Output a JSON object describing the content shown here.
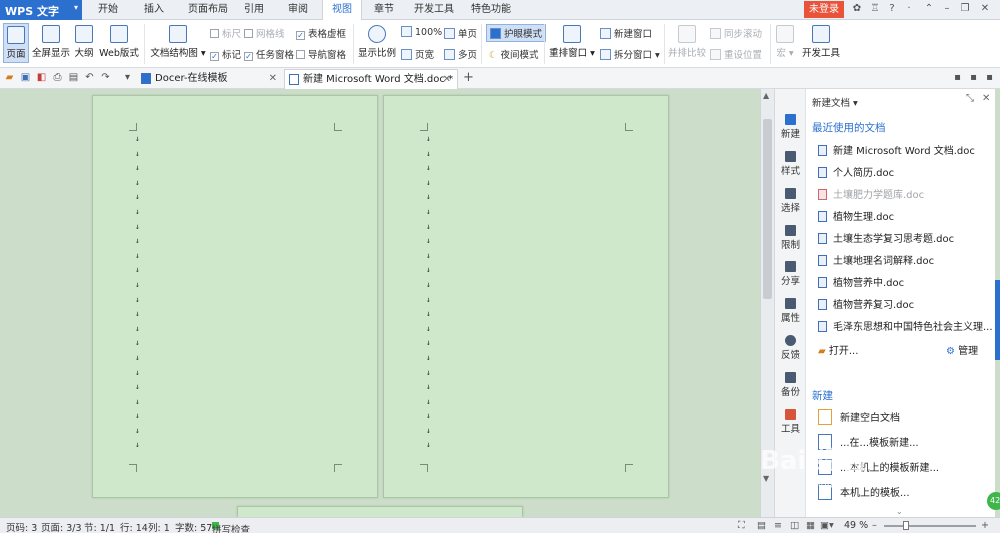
{
  "titlebar": {
    "app_menu": "WPS 文字",
    "tabs": [
      "开始",
      "插入",
      "页面布局",
      "引用",
      "审阅",
      "视图",
      "章节",
      "开发工具",
      "特色功能"
    ],
    "active_tab": "视图",
    "login": "未登录",
    "window_help": "?"
  },
  "ribbon": {
    "view_modes": [
      "页面",
      "全屏显示",
      "大纲",
      "Web版式"
    ],
    "doc_map": "文档结构图",
    "checks": [
      {
        "label": "标尺",
        "checked": false
      },
      {
        "label": "网格线",
        "checked": false
      },
      {
        "label": "表格虚框",
        "checked": true
      },
      {
        "label": "标记",
        "checked": true
      },
      {
        "label": "任务窗格",
        "checked": true
      },
      {
        "label": "导航窗格",
        "checked": false
      }
    ],
    "zoom": {
      "display_ratio": "显示比例",
      "pct": "100%",
      "page_width": "页宽",
      "single": "单页",
      "multi": "多页"
    },
    "eye_mode": "护眼模式",
    "night_mode": "夜间模式",
    "arrange": "重排窗口",
    "new_window": "新建窗口",
    "split_window": "拆分窗口",
    "side_by_side": "并排比较",
    "sync_scroll": "同步滚动",
    "reset_pos": "重设位置",
    "macro": "宏",
    "developer": "开发工具"
  },
  "doc_tabs": [
    {
      "label": "Docer-在线模板",
      "active": false
    },
    {
      "label": "新建 Microsoft Word 文档.doc *",
      "active": true
    }
  ],
  "pane": {
    "title": "新建文档",
    "recent_heading": "最近使用的文档",
    "recent": [
      {
        "name": "新建 Microsoft Word 文档.doc",
        "faded": false
      },
      {
        "name": "个人简历.doc",
        "faded": false
      },
      {
        "name": "土壤肥力学题库.doc",
        "faded": true
      },
      {
        "name": "植物生理.doc",
        "faded": false
      },
      {
        "name": "土壤生态学复习思考题.doc",
        "faded": false
      },
      {
        "name": "土壤地理名词解释.doc",
        "faded": false
      },
      {
        "name": "植物营养中.doc",
        "faded": false
      },
      {
        "name": "植物营养复习.doc",
        "faded": false
      },
      {
        "name": "毛泽东思想和中国特色社会主义理...",
        "faded": false
      }
    ],
    "open": "打开...",
    "manage": "管理",
    "new_heading": "新建",
    "new_items": [
      "新建空白文档",
      "...在...模板新建...",
      "...本机上的模板新建...",
      "本机上的模板..."
    ]
  },
  "sidenav": [
    "新建",
    "样式",
    "选择",
    "限制",
    "分享",
    "属性",
    "反馈",
    "备份",
    "工具"
  ],
  "statusbar": {
    "page_code": "页码: 3",
    "pages": "页面: 3/3",
    "section": "节: 1/1",
    "row": "行: 14",
    "col": "列: 1",
    "words": "字数: 57",
    "spell": "拼写检查",
    "zoom": "49 %"
  },
  "watermark": {
    "text": "Bai 经验",
    "url": "jingyan.baidu.com"
  },
  "icons": [
    "wps-logo-icon",
    "skin-icon",
    "shirt-icon",
    "help-icon",
    "minimize-icon",
    "restore-icon",
    "close-icon",
    "save-icon",
    "print-icon",
    "undo-icon",
    "redo-icon",
    "gear-icon"
  ],
  "colors": {
    "accent": "#2b6fcf",
    "login": "#e8533a",
    "page_bg": "#cfe8cc",
    "workspace": "#ccdec9"
  }
}
